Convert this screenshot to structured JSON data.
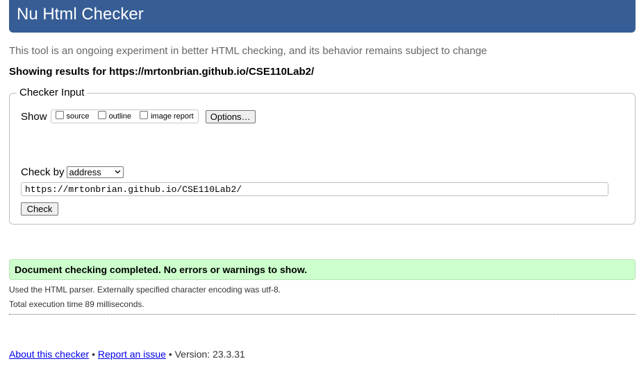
{
  "header": {
    "title": "Nu Html Checker"
  },
  "intro_text": "This tool is an ongoing experiment in better HTML checking, and its behavior remains subject to change",
  "results_for": "Showing results for https://mrtonbrian.github.io/CSE110Lab2/",
  "checker_input": {
    "legend": "Checker Input",
    "show_label": "Show",
    "show_options": [
      {
        "label": "source",
        "checked": false
      },
      {
        "label": "outline",
        "checked": false
      },
      {
        "label": "image report",
        "checked": false
      }
    ],
    "options_button": "Options…",
    "check_by_label": "Check by",
    "check_by_value": "address",
    "url_value": "https://mrtonbrian.github.io/CSE110Lab2/",
    "check_button": "Check"
  },
  "result": {
    "message": "Document checking completed. No errors or warnings to show.",
    "parser_note": "Used the HTML parser. Externally specified character encoding was utf-8.",
    "time_note": "Total execution time 89 milliseconds."
  },
  "footer": {
    "about_link": "About this checker",
    "separator": "•",
    "report_link": "Report an issue",
    "version": "• Version: 23.3.31"
  }
}
